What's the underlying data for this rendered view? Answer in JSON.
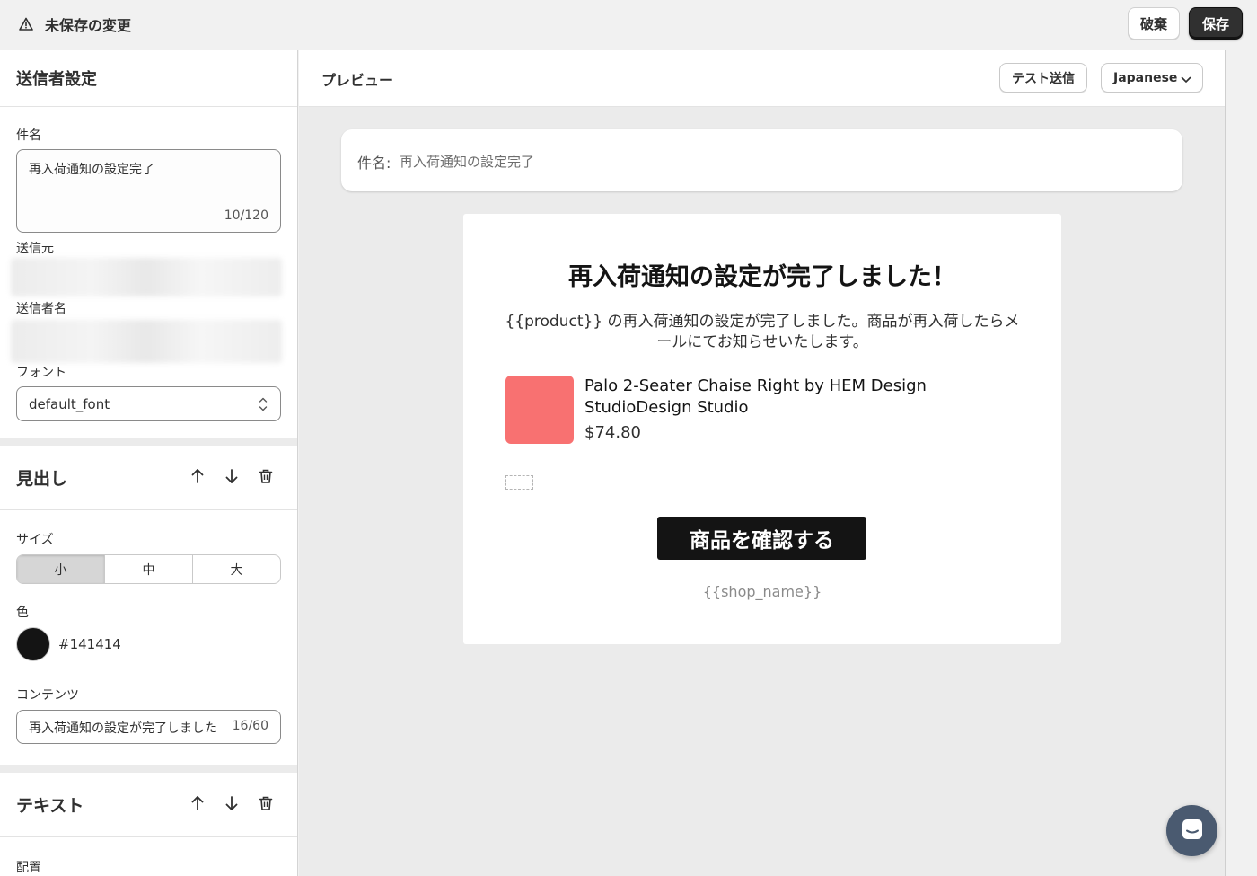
{
  "topbar": {
    "title": "未保存の変更",
    "discard_label": "破棄",
    "save_label": "保存"
  },
  "sender": {
    "section_title": "送信者設定",
    "subject_label": "件名",
    "subject_value": "再入荷通知の設定完了",
    "subject_count": "10/120",
    "from_label": "送信元",
    "sender_name_label": "送信者名",
    "font_label": "フォント",
    "font_value": "default_font"
  },
  "heading_block": {
    "title": "見出し",
    "size_label": "サイズ",
    "size_options": [
      "小",
      "中",
      "大"
    ],
    "size_selected": "小",
    "color_label": "色",
    "color_value": "#141414",
    "content_label": "コンテンツ",
    "content_value": "再入荷通知の設定が完了しました！",
    "content_count": "16/60"
  },
  "text_block": {
    "title": "テキスト",
    "align_label": "配置"
  },
  "preview": {
    "title": "プレビュー",
    "test_send_label": "テスト送信",
    "language": "Japanese",
    "subject_label": "件名:",
    "subject_value": "再入荷通知の設定完了",
    "email": {
      "heading": "再入荷通知の設定が完了しました！",
      "body": "{{product}} の再入荷通知の設定が完了しました。商品が再入荷したらメールにてお知らせいたします。",
      "product_name": "Palo 2-Seater Chaise Right by HEM Design StudioDesign Studio",
      "product_price": "$74.80",
      "cta_label": "商品を確認する",
      "shop_name": "{{shop_name}}",
      "product_image_color": "#f87171"
    }
  },
  "colors": {
    "primary_button": "#303030",
    "accent_dark": "#141414",
    "chat_bubble": "#4a5a70"
  }
}
